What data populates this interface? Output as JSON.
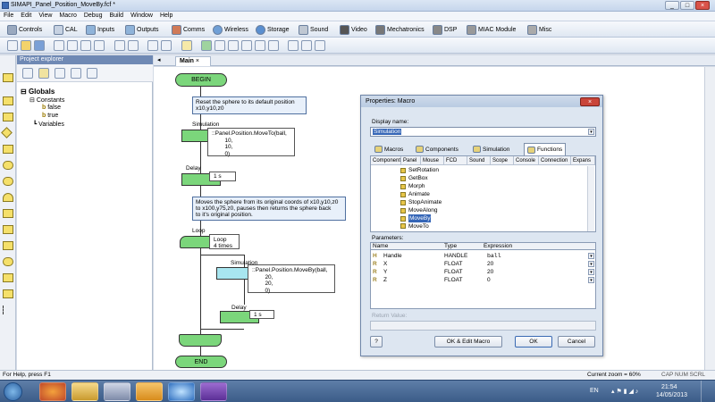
{
  "window": {
    "title": "SIMAPI_Panel_Position_MoveBy.fcf *"
  },
  "menu": [
    "File",
    "Edit",
    "View",
    "Macro",
    "Debug",
    "Build",
    "Window",
    "Help"
  ],
  "toolbar1": [
    {
      "label": "Controls",
      "icon": "gear-icon"
    },
    {
      "label": "CAL",
      "icon": "cal-icon"
    },
    {
      "label": "Inputs",
      "icon": "inputs-icon"
    },
    {
      "label": "Outputs",
      "icon": "outputs-icon"
    },
    {
      "label": "Comms",
      "icon": "comms-icon"
    },
    {
      "label": "Wireless",
      "icon": "wireless-icon"
    },
    {
      "label": "Storage",
      "icon": "storage-icon"
    },
    {
      "label": "Sound",
      "icon": "sound-icon"
    },
    {
      "label": "Video",
      "icon": "video-icon"
    },
    {
      "label": "Mechatronics",
      "icon": "mechatronics-icon"
    },
    {
      "label": "DSP",
      "icon": "dsp-icon"
    },
    {
      "label": "MIAC Module",
      "icon": "miac-icon"
    },
    {
      "label": "Misc",
      "icon": "misc-icon"
    }
  ],
  "explorer": {
    "title": "Project explorer",
    "tree": {
      "root": "Globals",
      "constants": "Constants",
      "false": "false",
      "true": "true",
      "variables": "Variables"
    }
  },
  "doc_tab": "Main",
  "flow": {
    "begin": "BEGIN",
    "end": "END",
    "comment1": "Reset the sphere to its default position\nx10,y10,z0",
    "sim1_label": "Simulation",
    "sim1_code": "::Panel.Position.MoveTo(ball,\n        10,\n        10,\n        0)",
    "delay1_label": "Delay",
    "delay1_value": "1 s",
    "comment2": "Moves the sphere from its original coords of x10,y10,z0\nto x100,y75,z0, pauses then returns the sphere back\nto it's original position.",
    "loop_label": "Loop",
    "loop_value": "Loop\n4 times",
    "sim2_label": "Simulation",
    "sim2_code": "::Panel.Position.MoveBy(ball,\n        20,\n        20,\n        0)",
    "delay2_label": "Delay",
    "delay2_value": "1 s"
  },
  "dialog": {
    "title": "Properties: Macro",
    "display_name_label": "Display name:",
    "display_name_value": "Simulation",
    "tabs": [
      "Macros",
      "Components",
      "Simulation",
      "Functions"
    ],
    "columns": [
      "Component",
      "Panel",
      "Mouse",
      "FCD",
      "Sound",
      "Scope",
      "Console",
      "Connection",
      "Expans"
    ],
    "functions": [
      "SetRotation",
      "GetBox",
      "Morph",
      "Animate",
      "StopAnimate",
      "MoveAlong",
      "MoveBy",
      "MoveTo"
    ],
    "selected_function": "MoveBy",
    "params_label": "Parameters:",
    "param_headers": [
      "Name",
      "Type",
      "Expression"
    ],
    "params": [
      {
        "icon": "H",
        "name": "Handle",
        "type": "HANDLE",
        "expr": "ball"
      },
      {
        "icon": "R",
        "name": "X",
        "type": "FLOAT",
        "expr": "20"
      },
      {
        "icon": "R",
        "name": "Y",
        "type": "FLOAT",
        "expr": "20"
      },
      {
        "icon": "R",
        "name": "Z",
        "type": "FLOAT",
        "expr": "0"
      }
    ],
    "return_label": "Return Value:",
    "help_btn": "?",
    "ok_edit_btn": "OK & Edit Macro",
    "ok_btn": "OK",
    "cancel_btn": "Cancel"
  },
  "status": {
    "left": "For Help, press F1",
    "zoom": "Current zoom = 60%",
    "indicators": "CAP  NUM  SCRL"
  },
  "taskbar": {
    "lang": "EN",
    "time": "21:54",
    "date": "14/05/2013"
  }
}
